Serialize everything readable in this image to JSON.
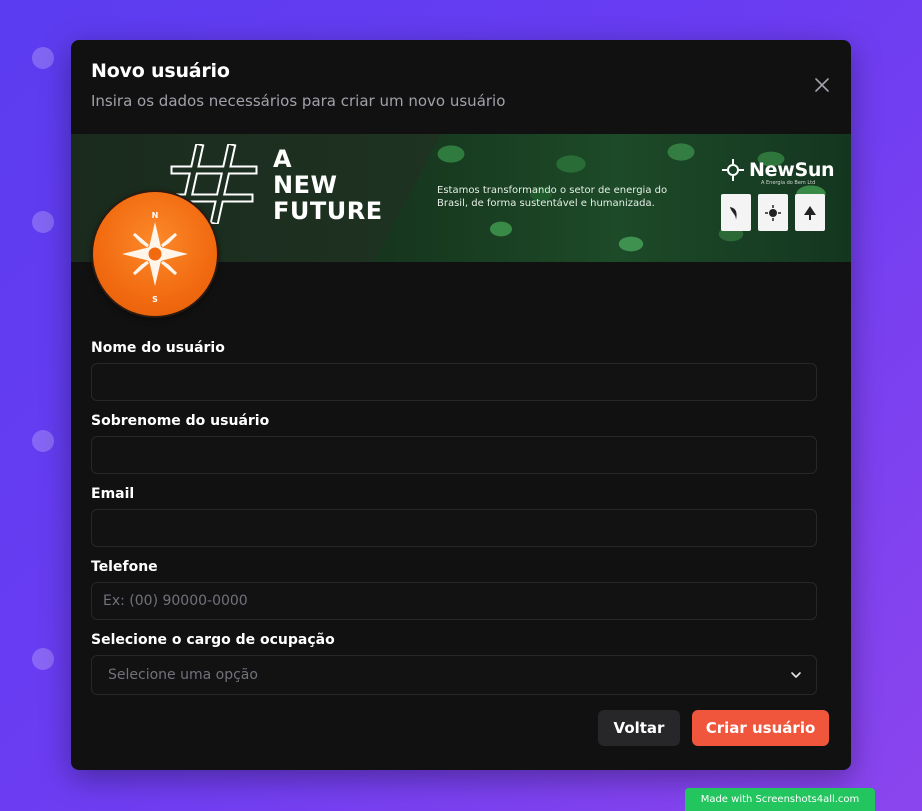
{
  "modal": {
    "title": "Novo usuário",
    "subtitle": "Insira os dados necessários para criar um novo usuário"
  },
  "banner": {
    "headline": [
      "A",
      "NEW",
      "FUTURE"
    ],
    "tagline": "Estamos transformando o setor de energia do Brasil, de forma sustentável e humanizada.",
    "brand": "NewSun",
    "brand_sub": "A Energia do Bem Ltd",
    "seals": [
      "EMPRESA NEUTRA EM CARBONO",
      "ENERGIA RENOVÁVEL",
      "EMPRESA PARCEIRA DA NATUREZA"
    ]
  },
  "form": {
    "first_name": {
      "label": "Nome do usuário",
      "value": "",
      "placeholder": ""
    },
    "last_name": {
      "label": "Sobrenome do usuário",
      "value": "",
      "placeholder": ""
    },
    "email": {
      "label": "Email",
      "value": "",
      "placeholder": ""
    },
    "phone": {
      "label": "Telefone",
      "value": "",
      "placeholder": "Ex: (00) 90000-0000"
    },
    "role": {
      "label": "Selecione o cargo de ocupação",
      "selected": "Selecione uma opção"
    }
  },
  "actions": {
    "back_label": "Voltar",
    "create_label": "Criar usuário"
  },
  "watermark": "Made with Screenshots4all.com",
  "colors": {
    "accent": "#f0563c",
    "modal_bg": "#111112",
    "input_border": "#27272a",
    "avatar": "#f26a10",
    "watermark": "#22c55e"
  },
  "icons": {
    "close": "close-icon",
    "select": "chevron-down-icon",
    "avatar": "compass-icon"
  }
}
